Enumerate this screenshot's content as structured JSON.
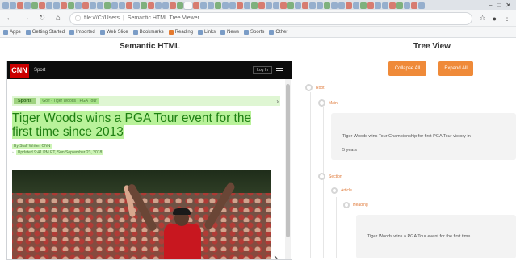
{
  "browser": {
    "url_host": "file:///C:/Users",
    "url_path": "Semantic HTML Tree Viewer",
    "bookmarks": [
      "Apps",
      "Getting Started",
      "Imported",
      "Web Slice",
      "Bookmarks",
      "Reading",
      "Links",
      "News",
      "Sports",
      "Other"
    ]
  },
  "left_title": "Semantic HTML",
  "right_title": "Tree View",
  "article": {
    "logo": "CNN",
    "section": "Sport",
    "login": "Log In",
    "breadcrumb_tag": "Sports",
    "breadcrumb_text": "Golf  ·  Tiger Woods  ·  PGA Tour",
    "headline": "Tiger Woods wins a PGA Tour event for the first time since 2013",
    "byline": "By Staff Writer, CNN",
    "updated": "Updated 9:41 PM ET, Sun September 23, 2018",
    "image_alt": "Tiger Woods celebrates with the crowd after winning the Tour Championship"
  },
  "tree": {
    "collapse_label": "Collapse All",
    "expand_label": "Expand All",
    "nodes": [
      "Root",
      "Main",
      "Section",
      "Article",
      "Heading"
    ],
    "text_1": "Tiger Woods wins Tour Championship for first PGA Tour victory in",
    "text_1b": "5 years",
    "text_2": "Tiger Woods wins a PGA Tour event for the first time"
  }
}
